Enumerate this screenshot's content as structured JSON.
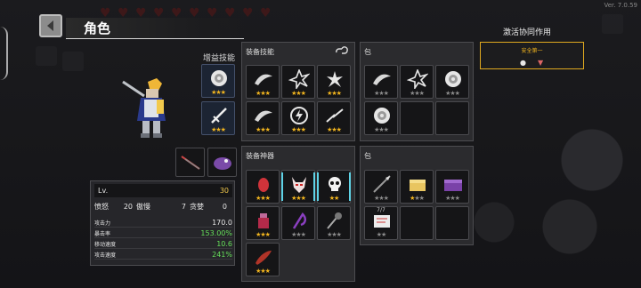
{
  "version": "Ver. 7.0.59",
  "header": {
    "title": "角色"
  },
  "skills_label": "增益技能",
  "equipped_skills_title": "装备技能",
  "equipped_artifacts_title": "装备神器",
  "bag_title_1": "包",
  "bag_title_2": "包",
  "synergy": {
    "title": "激活协同作用",
    "name": "安全第一"
  },
  "stats": {
    "lv_label": "Lv.",
    "lv_value": "30",
    "wrath_label": "愤怒",
    "wrath_value": "20",
    "pride_label": "傲慢",
    "pride_value": "7",
    "greed_label": "贪婪",
    "greed_value": "0",
    "attack_label": "攻击力",
    "attack_value": "170.0",
    "crit_label": "暴击率",
    "crit_value": "153.00%",
    "move_label": "移动速度",
    "move_value": "10.6",
    "atkspd_label": "攻击速度",
    "atkspd_value": "241%"
  },
  "bag_item_count": "7/7",
  "colors": {
    "gold": "#f2b51e",
    "green": "#66e05a",
    "cyan": "#5fd3e6"
  },
  "slots": {
    "buff_skills": [
      {
        "icon": "shield-swirl-icon",
        "stars": 3,
        "max": 3
      },
      {
        "icon": "sword-icon",
        "stars": 3,
        "max": 3
      }
    ],
    "equipped_skills": [
      {
        "icon": "wing-slash-icon",
        "stars": 3,
        "max": 3
      },
      {
        "icon": "lightning-burst-icon",
        "stars": 3,
        "max": 3
      },
      {
        "icon": "ice-burst-icon",
        "stars": 3,
        "max": 3
      },
      {
        "icon": "wing-slash-icon",
        "stars": 3,
        "max": 3
      },
      {
        "icon": "thunder-orb-icon",
        "stars": 3,
        "max": 3
      },
      {
        "icon": "lightning-bolt-icon",
        "stars": 3,
        "max": 3
      }
    ],
    "bag_skills": [
      {
        "icon": "wing-slash-icon",
        "stars": 0,
        "max": 3
      },
      {
        "icon": "lightning-burst-icon",
        "stars": 0,
        "max": 3
      },
      {
        "icon": "shield-swirl-icon",
        "stars": 0,
        "max": 3
      },
      {
        "icon": "shield-swirl-icon",
        "stars": 0,
        "max": 3
      }
    ],
    "artifacts": [
      {
        "icon": "egg-icon",
        "stars": 3,
        "max": 3
      },
      {
        "icon": "demon-mask-icon",
        "stars": 3,
        "max": 3
      },
      {
        "icon": "skull-icon",
        "stars": 2,
        "max": 2
      },
      {
        "icon": "potion-icon",
        "stars": 3,
        "max": 3
      },
      {
        "icon": "scythe-icon",
        "stars": 0,
        "max": 3
      },
      {
        "icon": "mace-icon",
        "stars": 0,
        "max": 3
      },
      {
        "icon": "horn-icon",
        "stars": 3,
        "max": 3
      }
    ],
    "bag_artifacts": [
      {
        "icon": "spear-icon",
        "stars": 0,
        "max": 3
      },
      {
        "icon": "treasure-box-icon",
        "stars": 1,
        "max": 3
      },
      {
        "icon": "purple-chest-icon",
        "stars": 0,
        "max": 3
      },
      {
        "icon": "scroll-card-icon",
        "stars": 0,
        "max": 2
      }
    ]
  }
}
